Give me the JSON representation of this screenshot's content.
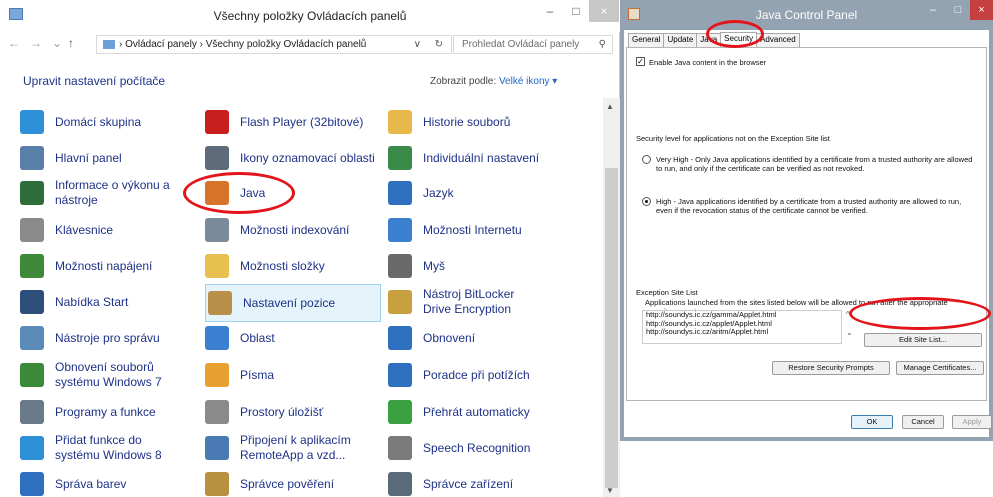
{
  "control_panel": {
    "window_title": "Všechny položky Ovládacích panelů",
    "win_min": "–",
    "win_max": "□",
    "win_close": "×",
    "nav_back": "←",
    "nav_forward": "→",
    "nav_recent": "⌄",
    "nav_up": "↑",
    "breadcrumb": "›  Ovládací panely  ›  Všechny položky Ovládacích panelů",
    "addr_dropdown": "∨",
    "addr_refresh": "↻",
    "search_placeholder": "Prohledat Ovládací panely",
    "search_icon": "⚲",
    "heading": "Upravit nastavení počítače",
    "view_by_label": "Zobrazit podle:",
    "view_by_value": "Velké ikony ▾",
    "scroll_up": "▲",
    "scroll_down": "▼",
    "items": [
      {
        "label": "Domácí skupina",
        "icon": "homegroup-icon",
        "color": "#2e8fd9"
      },
      {
        "label": "Flash Player (32bitové)",
        "icon": "flash-player-icon",
        "color": "#c81e1e"
      },
      {
        "label": "Historie souborů",
        "icon": "file-history-icon",
        "color": "#e8b84a"
      },
      {
        "label": "Hlavní panel",
        "icon": "taskbar-icon",
        "color": "#5a7fa8"
      },
      {
        "label": "Ikony oznamovací oblasti",
        "icon": "notification-icons-icon",
        "color": "#5d6b7a"
      },
      {
        "label": "Individuální nastavení",
        "icon": "personalization-icon",
        "color": "#3a8a4a"
      },
      {
        "label": "Informace o výkonu a nástroje",
        "icon": "performance-icon",
        "color": "#2f6e3a"
      },
      {
        "label": "Java",
        "icon": "java-icon",
        "color": "#d8732a"
      },
      {
        "label": "Jazyk",
        "icon": "language-icon",
        "color": "#2e6fc0"
      },
      {
        "label": "Klávesnice",
        "icon": "keyboard-icon",
        "color": "#8a8a8a"
      },
      {
        "label": "Možnosti indexování",
        "icon": "indexing-icon",
        "color": "#7a8a9a"
      },
      {
        "label": "Možnosti Internetu",
        "icon": "internet-options-icon",
        "color": "#3a7fd0"
      },
      {
        "label": "Možnosti napájení",
        "icon": "power-icon",
        "color": "#3f8a3a"
      },
      {
        "label": "Možnosti složky",
        "icon": "folder-options-icon",
        "color": "#e8c050"
      },
      {
        "label": "Myš",
        "icon": "mouse-icon",
        "color": "#6a6a6a"
      },
      {
        "label": "Nabídka Start",
        "icon": "start-menu-icon",
        "color": "#2d4d7a"
      },
      {
        "label": "Nastavení pozice",
        "icon": "location-settings-icon",
        "color": "#b8904a"
      },
      {
        "label": "Nástroj BitLocker Drive Encryption",
        "icon": "bitlocker-icon",
        "color": "#c8a040"
      },
      {
        "label": "Nástroje pro správu",
        "icon": "admin-tools-icon",
        "color": "#5a8ab8"
      },
      {
        "label": "Oblast",
        "icon": "region-icon",
        "color": "#3a7fd0"
      },
      {
        "label": "Obnovení",
        "icon": "recovery-icon",
        "color": "#2e6fc0"
      },
      {
        "label": "Obnovení souborů systému Windows 7",
        "icon": "windows7-recovery-icon",
        "color": "#3a8a3a"
      },
      {
        "label": "Písma",
        "icon": "fonts-icon",
        "color": "#e8a030"
      },
      {
        "label": "Poradce při potížích",
        "icon": "troubleshooting-icon",
        "color": "#2e6fc0"
      },
      {
        "label": "Programy a funkce",
        "icon": "programs-icon",
        "color": "#6a7a8a"
      },
      {
        "label": "Prostory úložišť",
        "icon": "storage-spaces-icon",
        "color": "#8a8a8a"
      },
      {
        "label": "Přehrát automaticky",
        "icon": "autoplay-icon",
        "color": "#3aa040"
      },
      {
        "label": "Přidat funkce do systému Windows 8",
        "icon": "add-features-icon",
        "color": "#2e8fd9"
      },
      {
        "label": "Připojení k aplikacím RemoteApp a vzd...",
        "icon": "remoteapp-icon",
        "color": "#4a7ab4"
      },
      {
        "label": "Speech Recognition",
        "icon": "microphone-icon",
        "color": "#7a7a7a"
      },
      {
        "label": "Správa barev",
        "icon": "color-management-icon",
        "color": "#2e6fc0"
      },
      {
        "label": "Správce pověření",
        "icon": "credential-manager-icon",
        "color": "#b89040"
      },
      {
        "label": "Správce zařízení",
        "icon": "device-manager-icon",
        "color": "#5a6a7a"
      }
    ]
  },
  "java": {
    "window_title": "Java Control Panel",
    "win_min": "–",
    "win_max": "□",
    "win_close": "×",
    "tabs": [
      "General",
      "Update",
      "Java",
      "Security",
      "Advanced"
    ],
    "active_tab": "Security",
    "enable_label": "Enable Java content in the browser",
    "enable_checked": true,
    "level_title": "Security level for applications not on the Exception Site list",
    "very_high": "Very High - Only Java applications identified by a certificate from a trusted authority are allowed to run, and only if the certificate can be verified as not revoked.",
    "high": "High - Java applications identified by a certificate from a trusted authority are allowed to run, even if the revocation status of the certificate cannot be verified.",
    "selected_level": "high",
    "exception_title": "Exception Site List",
    "exception_desc": "Applications launched from the sites listed below will be allowed to run after the appropriate security prompts.",
    "sites": [
      "http://soundys.ic.cz/gamma/Applet.html",
      "http://soundys.ic.cz/applet/Applet.html",
      "http://soundys.ic.cz/aritm/Applet.html"
    ],
    "site_scroll_up": "^",
    "site_scroll_down": "⌄",
    "edit_site_list": "Edit Site List...",
    "restore_prompts": "Restore Security Prompts",
    "manage_certs": "Manage Certificates...",
    "ok": "OK",
    "cancel": "Cancel",
    "apply": "Apply"
  }
}
